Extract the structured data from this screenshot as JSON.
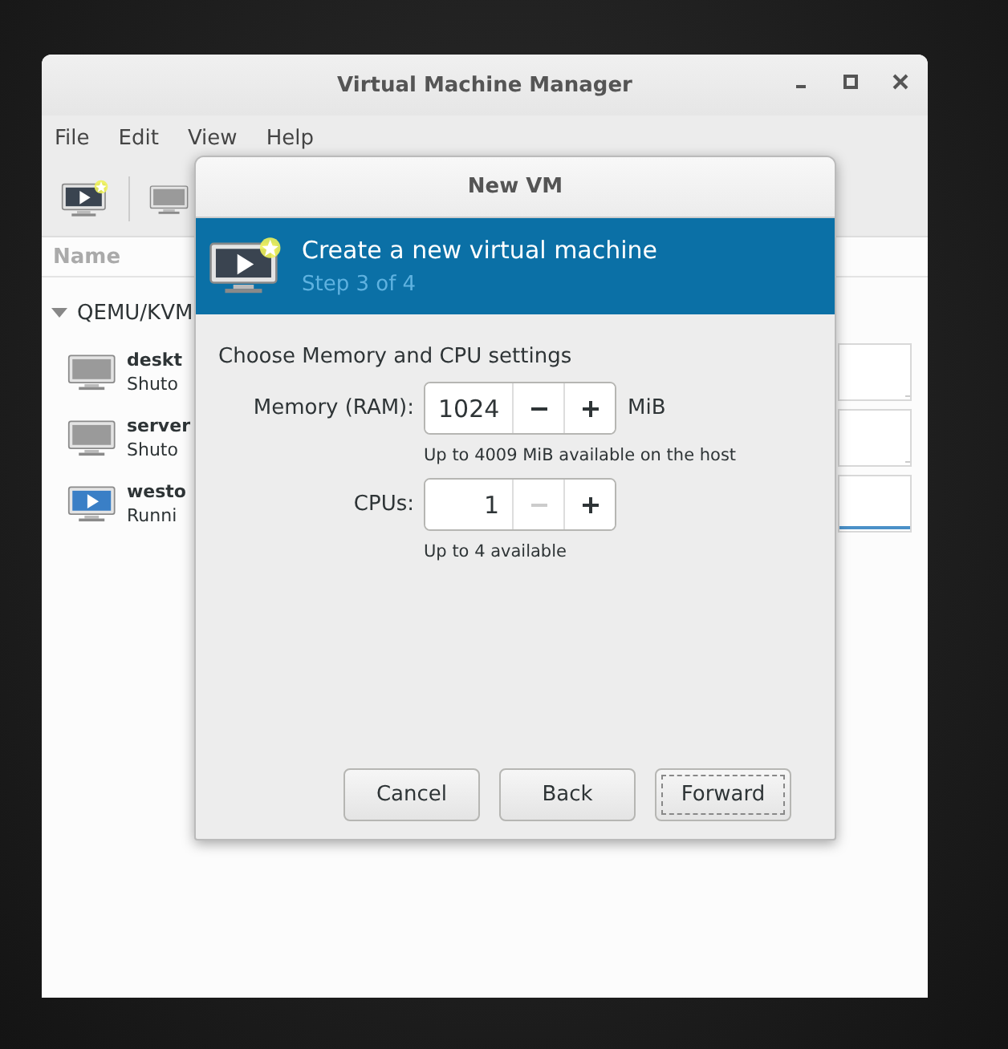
{
  "main_window": {
    "title": "Virtual Machine Manager",
    "menu": [
      "File",
      "Edit",
      "View",
      "Help"
    ],
    "list_header": "Name",
    "group": {
      "label": "QEMU/KVM",
      "expanded": true
    },
    "vms": [
      {
        "name": "deskt",
        "status": "Shuto",
        "running": false
      },
      {
        "name": "server",
        "status": "Shuto",
        "running": false
      },
      {
        "name": "westo",
        "status": "Runni",
        "running": true
      }
    ]
  },
  "dialog": {
    "title": "New VM",
    "banner": {
      "title": "Create a new virtual machine",
      "step": "Step 3 of 4"
    },
    "heading": "Choose Memory and CPU settings",
    "fields": [
      {
        "label": "Memory (RAM):",
        "value": "1024",
        "unit": "MiB",
        "hint": "Up to 4009 MiB available on the host",
        "decrement_disabled": false,
        "increment_disabled": false
      },
      {
        "label": "CPUs:",
        "value": "1",
        "hint": "Up to 4 available",
        "decrement_disabled": true,
        "increment_disabled": false
      }
    ],
    "buttons": [
      {
        "label": "Cancel",
        "focused": false
      },
      {
        "label": "Back",
        "focused": false
      },
      {
        "label": "Forward",
        "focused": true
      }
    ]
  }
}
